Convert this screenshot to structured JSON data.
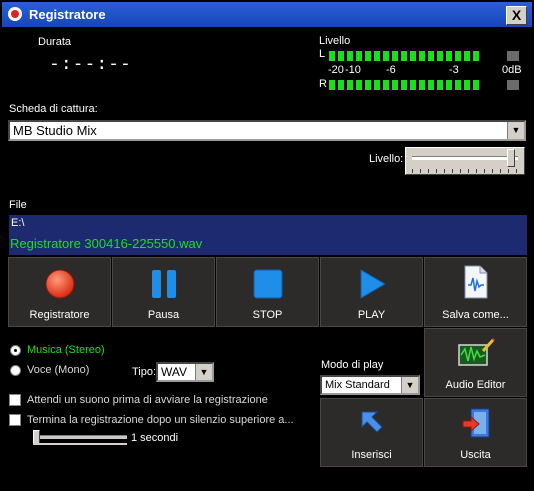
{
  "window": {
    "title": "Registratore",
    "close_label": "X"
  },
  "duration": {
    "label": "Durata",
    "value": "-:--:--"
  },
  "level": {
    "label": "Livello",
    "left_channel": "L",
    "right_channel": "R",
    "scale": [
      "-20",
      "-10",
      "-6",
      "-3",
      "0dB"
    ],
    "meter_color": "#19e019"
  },
  "capture": {
    "label": "Scheda di cattura:",
    "selected": "MB Studio Mix"
  },
  "input_level": {
    "label": "Livello:",
    "value_percent": 97
  },
  "file": {
    "label": "File",
    "path": "E:\\",
    "name": "Registratore 300416-225550.wav",
    "name_color": "#19e019"
  },
  "buttons": {
    "record": "Registratore",
    "pause": "Pausa",
    "stop": "STOP",
    "play": "PLAY",
    "save_as": "Salva come...",
    "audio_editor": "Audio Editor",
    "insert": "Inserisci",
    "exit": "Uscita"
  },
  "mode": {
    "music": "Musica (Stereo)",
    "voice": "Voce (Mono)",
    "selected": "music",
    "type_label": "Tipo:",
    "type_value": "WAV"
  },
  "options": {
    "wait_sound": "Attendi un suono prima di avviare la registrazione",
    "stop_silence": "Termina la registrazione dopo un silenzio superiore a...",
    "silence_seconds": "1 secondi",
    "silence_slider_percent": 0
  },
  "play_mode": {
    "label": "Modo di play",
    "selected": "Mix Standard"
  }
}
